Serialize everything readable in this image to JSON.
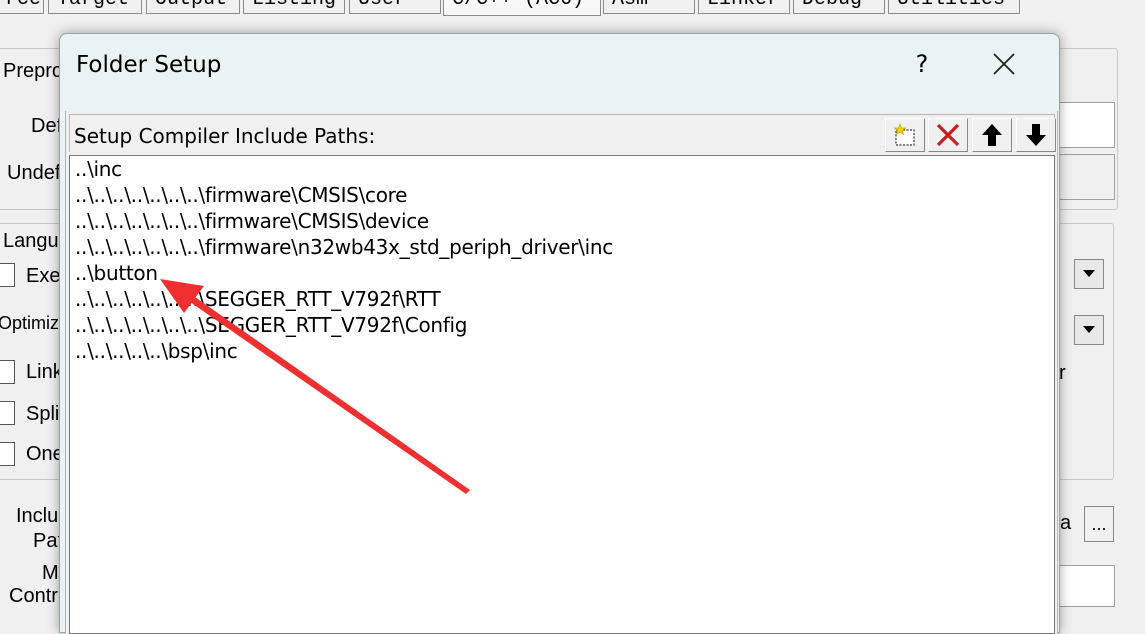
{
  "background": {
    "tabs": [
      {
        "label": "rce"
      },
      {
        "label": "Target"
      },
      {
        "label": "Output"
      },
      {
        "label": "Listing"
      },
      {
        "label": "User"
      },
      {
        "label": "C/C++ (AC6)"
      },
      {
        "label": "Asm"
      },
      {
        "label": "Linker"
      },
      {
        "label": "Debug"
      },
      {
        "label": "Utilities"
      }
    ],
    "labels": {
      "preprocessor": "Prepro",
      "define": "Def",
      "undefine": "Undef",
      "language": "Langu",
      "execute_only": "Exe",
      "optimization": "Optimiz",
      "link_time": "Link",
      "split": "Spli",
      "one_elf": "One",
      "include_paths_1": "Inclu",
      "include_paths_2": "Pat",
      "misc_1": "M",
      "misc_2": "Contr",
      "right_r": "r",
      "right_a": "a",
      "dots": "..."
    }
  },
  "dialog": {
    "title": "Folder Setup",
    "help_label": "?",
    "header_label": "Setup Compiler Include Paths:",
    "toolbar": {
      "new_icon": "new-folder-icon",
      "delete_icon": "delete-icon",
      "up_icon": "move-up-icon",
      "down_icon": "move-down-icon"
    },
    "paths": [
      "..\\inc",
      "..\\..\\..\\..\\..\\..\\..\\firmware\\CMSIS\\core",
      "..\\..\\..\\..\\..\\..\\..\\firmware\\CMSIS\\device",
      "..\\..\\..\\..\\..\\..\\..\\firmware\\n32wb43x_std_periph_driver\\inc",
      "..\\button",
      "..\\..\\..\\..\\..\\..\\..\\SEGGER_RTT_V792f\\RTT",
      "..\\..\\..\\..\\..\\..\\..\\SEGGER_RTT_V792f\\Config",
      "..\\..\\..\\..\\..\\bsp\\inc"
    ]
  },
  "annotation": {
    "arrow_color": "#f03030"
  }
}
